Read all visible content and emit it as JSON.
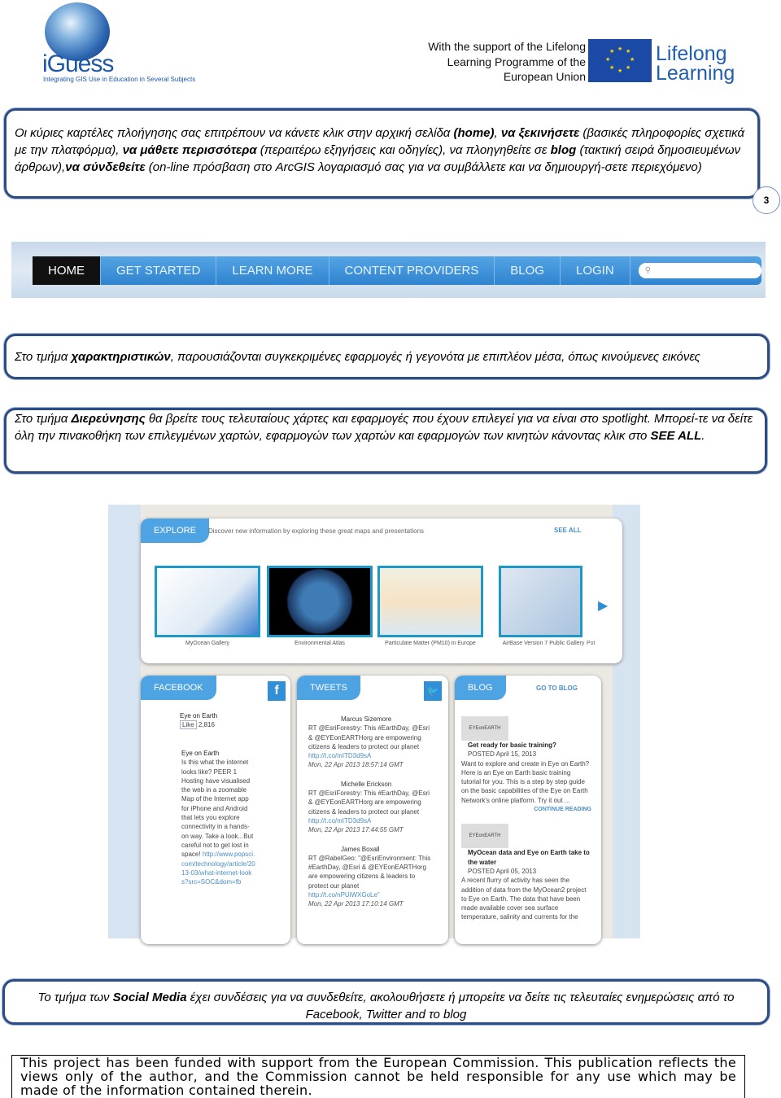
{
  "header": {
    "logo_name": "iGuess",
    "logo_tagline": "Integrating GIS Use in Education in Several Subjects",
    "eu_support": [
      "With the support of the Lifelong",
      "Learning Programme of the",
      "European Union"
    ],
    "lifelong_learning": [
      "Lifelong",
      "Learning"
    ]
  },
  "box1": {
    "parts": [
      {
        "t": "Οι κύριες καρτέλες πλοήγησης σας επιτρέπουν να κάνετε κλικ στην αρχική σελίδα ",
        "b": false
      },
      {
        "t": "(home)",
        "b": true
      },
      {
        "t": ", ",
        "b": false
      },
      {
        "t": "να ξεκινήσετε",
        "b": true
      },
      {
        "t": " (βασικές πληροφορίες σχετικά με την πλατφόρμα), ",
        "b": false
      },
      {
        "t": "να μάθετε  περισσότερα",
        "b": true
      },
      {
        "t": " (περαιτέρω εξηγήσεις και οδηγίες), να πλοηγηθείτε σε  ",
        "b": false
      },
      {
        "t": "blog",
        "b": true
      },
      {
        "t": " (τακτική σειρά δημοσιευμένων άρθρων),",
        "b": false
      },
      {
        "t": "να  σύνδεθείτε",
        "b": true
      },
      {
        "t": " (on-line πρόσβαση στο ArcGIS λογαριασμό σας για να συμβάλλετε και να δημιουργή-σετε περιεχόμενο)",
        "b": false
      }
    ]
  },
  "page_number": "3",
  "nav": {
    "items": [
      "HOME",
      "GET STARTED",
      "LEARN MORE",
      "CONTENT PROVIDERS",
      "BLOG",
      "LOGIN"
    ]
  },
  "box2": {
    "pre": "Στο τμήμα ",
    "bold": "χαρακτηριστικών",
    "post": ", παρουσιάζονται συγκεκριμένες εφαρμογές ή γεγονότα με επιπλέον μέσα, όπως κινούμενες εικόνες"
  },
  "box3": {
    "pre": "Στο τμήμα ",
    "bold": "Διερεύνησης",
    "mid": " θα βρείτε τους τελευταίους χάρτες και εφαρμογές που έχουν επιλεγεί για να είναι στο  spotlight. Μπορεί-τε να δείτε όλη την πινακοθήκη των επιλεγμένων χαρτών, εφαρμογών των χαρτών και  εφαρμογών των κινητών κάνοντας κλικ στο ",
    "bold2": "SEE ALL",
    "post": "."
  },
  "explore": {
    "tab": "EXPLORE",
    "desc": "Discover new information by exploring these great maps and presentations",
    "see_all": "SEE ALL",
    "items": [
      "MyOcean Gallery",
      "Environmental Atlas",
      "Particulate Matter (PM10) in Europe",
      "AirBase Version 7 Public Gallery",
      "Pot"
    ]
  },
  "facebook": {
    "tab": "FACEBOOK",
    "page": "Eye on Earth",
    "like": "Like",
    "likes": "2,816",
    "post_author": "Eye on Earth",
    "post_text": "Is this what the internet looks like? PEER 1 Hosting have visualised the web in a zoomable Map of the Internet app for iPhone and Android that lets you explore connectivity in a hands-on way. Take a look...But careful not to get lost in space!",
    "post_link": "http://www.popsci.com/technology/article/2013-03/what-internet-looks?src=SOC&dom=fb"
  },
  "tweets": {
    "tab": "TWEETS",
    "items": [
      {
        "author": "Marcus Sizemore",
        "text": "RT @EsriForestry: This #EarthDay, @Esri & @EYEonEARTHorg are empowering citizens & leaders to protect our planet ",
        "link": "http://t.co/mITD3d9sA",
        "date": "Mon, 22 Apr 2013 18:57:14 GMT"
      },
      {
        "author": "Michelle Erickson",
        "text": "RT @EsriForestry: This #EarthDay, @Esri & @EYEonEARTHorg are empowering citizens & leaders to protect our planet ",
        "link": "http://t.co/mITD3d9sA",
        "date": "Mon, 22 Apr 2013 17:44:55 GMT"
      },
      {
        "author": "James Boxall",
        "text": "RT @RabelGeo: \"@EsriEnvironment: This #EarthDay, @Esri & @EYEonEARTHorg are empowering citizens & leaders to protect our planet ",
        "link": "http://t.co/nPUiWXGoLe\"",
        "date": "Mon, 22 Apr 2013 17:10:14 GMT"
      }
    ]
  },
  "blog": {
    "tab": "BLOG",
    "go_to": "GO TO BLOG",
    "logo": "EYEonEARTH",
    "continue": "CONTINUE READING",
    "posts": [
      {
        "title": "Get ready for basic training?",
        "date": "POSTED April 15, 2013",
        "text": "Want to explore and create in Eye on Earth? Here is an Eye on Earth basic training tutorial for you. This is a step by step guide on the basic capabilities of the Eye on Earth Network's online platform. Try it out ..."
      },
      {
        "title": "MyOcean data and Eye on Earth take to the water",
        "date": "POSTED April 05, 2013",
        "text": "A recent flurry of activity has seen the addition of data from the MyOcean2 project to Eye on Earth. The data that have been made available cover sea surface temperature, salinity and currents for the"
      }
    ]
  },
  "box4": {
    "pre": "Το τμήμα των  ",
    "bold": "Social Media",
    "post": " έχει συνδέσεις για να συνδεθείτε, ακολουθήσετε ή μπορείτε να δείτε τις τελευταίες  ενημερώσεις από το Facebook, Twitter and το blog"
  },
  "footer": "This project has been funded with support from the European Commission. This publication reflects the views only of the author, and the Commission cannot be held responsible for any use which may be made of the information contained therein.",
  "colors": {
    "frame": "#2d4d82",
    "nav_blue": "#3a8fd0",
    "tab_blue": "#4ea3e3"
  }
}
